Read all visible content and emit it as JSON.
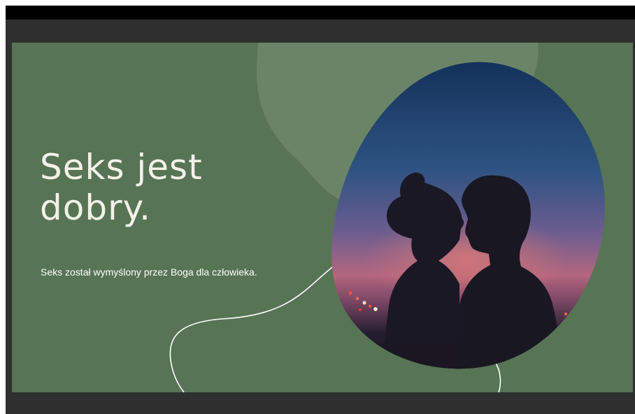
{
  "slide": {
    "title_line1": "Seks jest",
    "title_line2": "dobry.",
    "subtitle": "Seks został wymyślony przez Boga dla człowieka."
  },
  "colors": {
    "viewer_background": "#2f2f2f",
    "top_bar": "#000000",
    "slide_background": "#577454",
    "light_blob": "#6a8468",
    "text": "#f4f1e8",
    "line": "#ffffff"
  },
  "image": {
    "subject": "couple-silhouette-at-sunset"
  }
}
